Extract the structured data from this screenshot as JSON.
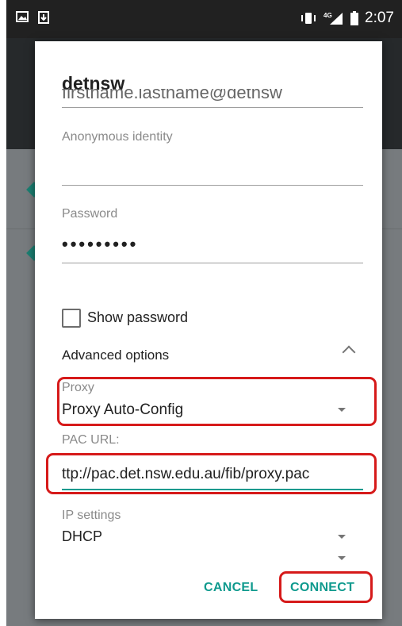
{
  "status_bar": {
    "time": "2:07",
    "network_label": "4G",
    "icons": [
      "image-notification-icon",
      "download-notification-icon",
      "vibrate-icon",
      "signal-icon",
      "battery-icon"
    ]
  },
  "dialog": {
    "title": "detnsw",
    "identity_value": "firstname.lastname@detnsw",
    "anonymous_identity": {
      "label": "Anonymous identity",
      "value": ""
    },
    "password": {
      "label": "Password",
      "value": "•••••••••"
    },
    "show_password": {
      "label": "Show password",
      "checked": false
    },
    "advanced": {
      "label": "Advanced options",
      "expanded": true
    },
    "proxy": {
      "label": "Proxy",
      "value": "Proxy Auto-Config"
    },
    "pac_url": {
      "label": "PAC URL:",
      "value": "ttp://pac.det.nsw.edu.au/fib/proxy.pac"
    },
    "ip_settings": {
      "label": "IP settings",
      "value": "DHCP"
    },
    "buttons": {
      "cancel": "CANCEL",
      "connect": "CONNECT"
    }
  },
  "colors": {
    "accent": "#0f9a8e",
    "highlight": "#d61a1a",
    "status_bar": "#212121",
    "dim_background": "#777b7e"
  }
}
